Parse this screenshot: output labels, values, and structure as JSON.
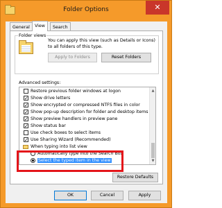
{
  "window": {
    "title": "Folder Options",
    "close_glyph": "✕"
  },
  "tabs": [
    {
      "label": "General"
    },
    {
      "label": "View"
    },
    {
      "label": "Search"
    }
  ],
  "folder_views": {
    "group_label": "Folder views",
    "description": "You can apply this view (such as Details or Icons) to all folders of this type.",
    "apply_label": "Apply to Folders",
    "reset_label": "Reset Folders"
  },
  "advanced": {
    "label": "Advanced settings:",
    "items": [
      {
        "label": "Restore previous folder windows at logon",
        "checked": false
      },
      {
        "label": "Show drive letters",
        "checked": true
      },
      {
        "label": "Show encrypted or compressed NTFS files in color",
        "checked": true
      },
      {
        "label": "Show pop-up description for folder and desktop items",
        "checked": true
      },
      {
        "label": "Show preview handlers in preview pane",
        "checked": true
      },
      {
        "label": "Show status bar",
        "checked": true
      },
      {
        "label": "Use check boxes to select items",
        "checked": false
      },
      {
        "label": "Use Sharing Wizard (Recommended)",
        "checked": true
      }
    ],
    "typing_group": "When typing into list view",
    "radio_options": [
      {
        "label": "Automatically type into the Search Box",
        "selected": false
      },
      {
        "label": "Select the typed item in the view",
        "selected": true
      }
    ],
    "restore_defaults_label": "Restore Defaults"
  },
  "footer": {
    "ok": "OK",
    "cancel": "Cancel",
    "apply": "Apply"
  }
}
